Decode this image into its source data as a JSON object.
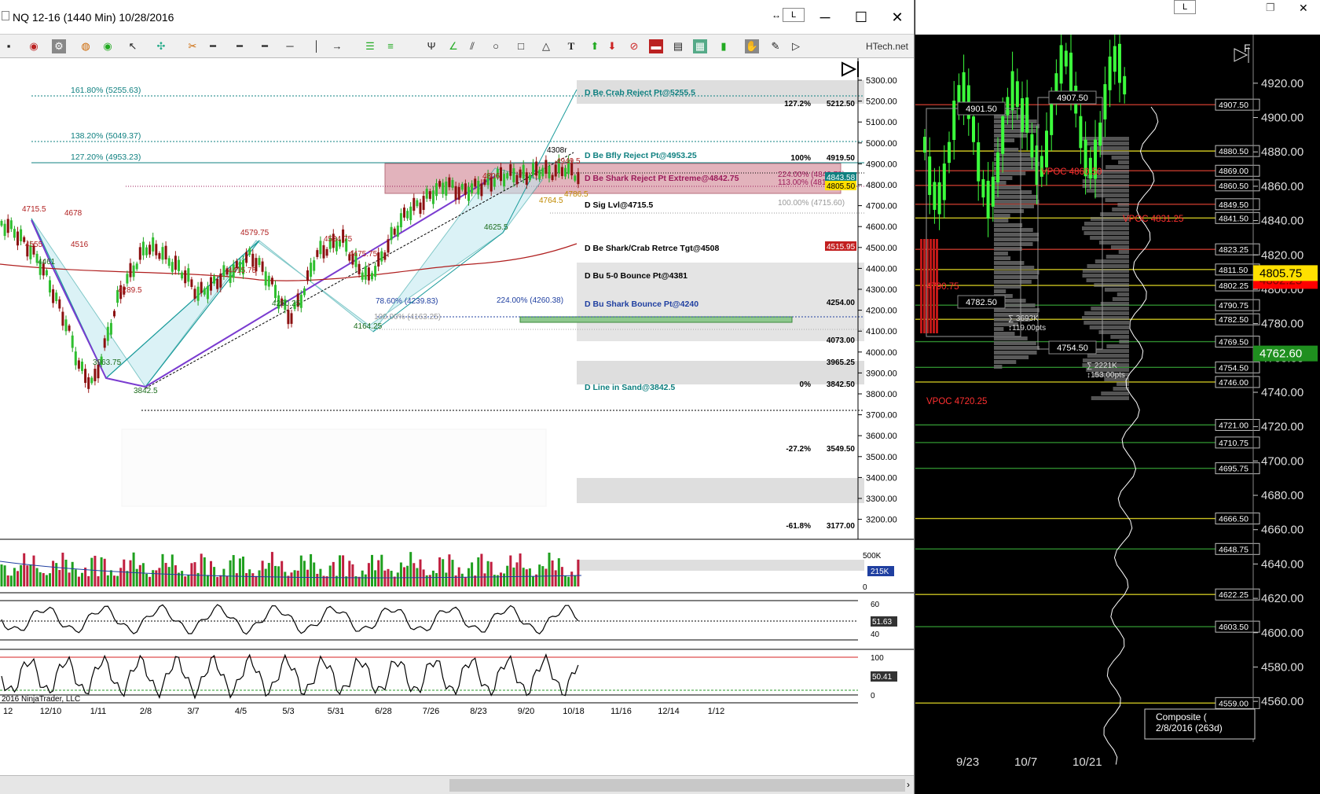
{
  "left_window": {
    "title": "NQ 12-16 (1440 Min)  10/28/2016",
    "buttons": {
      "minimize": "─",
      "maximize": "☐",
      "close": "✕",
      "link": "L"
    },
    "toolbar_brand": "HTech.net",
    "price_axis": [
      "5300.00",
      "5200.00",
      "5100.00",
      "5000.00",
      "4900.00",
      "4800.00",
      "4700.00",
      "4600.00",
      "4500.00",
      "4400.00",
      "4300.00",
      "4200.00",
      "4100.00",
      "4000.00",
      "3900.00",
      "3800.00",
      "3700.00",
      "3600.00",
      "3500.00",
      "3400.00",
      "3300.00",
      "3200.00"
    ],
    "date_axis": [
      "12",
      "12/10",
      "1/11",
      "2/8",
      "3/7",
      "4/5",
      "5/3",
      "5/31",
      "6/28",
      "7/26",
      "8/23",
      "9/20",
      "10/18",
      "11/16",
      "12/14",
      "1/12"
    ],
    "fib_labels": [
      "161.80% (5255.63)",
      "138.20% (5049.37)",
      "127.20% (4953.23)"
    ],
    "zones": [
      {
        "label": "D Be Crab Reject Pt@5255.5",
        "color": "#0f8080"
      },
      {
        "label": "D Be Bfly Reject Pt@4953.25",
        "color": "#0f8080"
      },
      {
        "label": "D Be Shark Reject Pt Extreme@4842.75",
        "color": "#9b1b5a"
      },
      {
        "label": "D Sig Lvl@4715.5",
        "color": "#000000"
      },
      {
        "label": "D Be Shark/Crab Retrce Tgt@4508",
        "color": "#000000"
      },
      {
        "label": "D Bu 5-0 Bounce Pt@4381",
        "color": "#000000"
      },
      {
        "label": "D Bu Shark Bounce Pt@4240",
        "color": "#1f3fa0"
      },
      {
        "label": "D Line in Sand@3842.5",
        "color": "#0f8080"
      }
    ],
    "level_labels": [
      {
        "pct": "127.2%",
        "price": "5212.50"
      },
      {
        "pct": "100%",
        "price": "4919.50"
      },
      {
        "pct": "",
        "price": "4508.00"
      },
      {
        "pct": "",
        "price": "4254.00"
      },
      {
        "pct": "",
        "price": "4073.00"
      },
      {
        "pct": "",
        "price": "3965.25"
      },
      {
        "pct": "0%",
        "price": "3842.50"
      },
      {
        "pct": "-27.2%",
        "price": "3549.50"
      },
      {
        "pct": "-61.8%",
        "price": "3177.00"
      }
    ],
    "small_labels": [
      "224.00% (4842.78)",
      "113.00% (4817.30)",
      "100.00% (4715.60)",
      "224.00% (4260.38)",
      "78.60% (4239.83)",
      "100.00% (4163.25)"
    ],
    "price_tags": {
      "high": "4843.58",
      "current": "4805.50",
      "ma": "4515.95",
      "volume": "215K",
      "rsi": "51.63",
      "stoch": "50.41"
    },
    "pivot_labels": [
      "4715.5",
      "4678",
      "4555",
      "4461",
      "4516",
      "3963.75",
      "3842.5",
      "4289.5",
      "4579.75",
      "4415.75",
      "4260.25",
      "4534.75",
      "4475.75",
      "4164.25",
      "4806",
      "4625.5",
      "4308r",
      "4949.5",
      "4764.5",
      "4786.5"
    ],
    "volume_axis": [
      "500K",
      "0"
    ],
    "rsi_axis": [
      "60",
      "40"
    ],
    "stoch_axis": [
      "100",
      "0"
    ],
    "copyright": "2016 NinjaTrader, LLC",
    "panel_button": "F"
  },
  "right_window": {
    "buttons": {
      "link": "L",
      "restore": "❐",
      "close": "✕",
      "panel": "F"
    },
    "price_axis": [
      "4920.00",
      "4900.00",
      "4880.00",
      "4860.00",
      "4840.00",
      "4820.00",
      "4800.00",
      "4780.00",
      "4760.00",
      "4740.00",
      "4720.00",
      "4700.00",
      "4680.00",
      "4660.00",
      "4640.00",
      "4620.00",
      "4600.00",
      "4580.00",
      "4560.00"
    ],
    "levels": [
      {
        "price": "4907.50",
        "color": "#c0392b"
      },
      {
        "price": "4880.50",
        "color": "#c8c020"
      },
      {
        "price": "4869.00",
        "color": "#c0392b"
      },
      {
        "price": "4860.50",
        "color": "#c0392b"
      },
      {
        "price": "4849.50",
        "color": "#c0392b"
      },
      {
        "price": "4841.50",
        "color": "#c8c020"
      },
      {
        "price": "4823.25",
        "color": "#c0392b"
      },
      {
        "price": "4811.50",
        "color": "#c8c020"
      },
      {
        "price": "4802.25",
        "color": "#c8c020"
      },
      {
        "price": "4790.75",
        "color": "#2e8b2e"
      },
      {
        "price": "4782.50",
        "color": "#c8c020"
      },
      {
        "price": "4769.50",
        "color": "#2e8b2e"
      },
      {
        "price": "4754.50",
        "color": "#2e8b2e"
      },
      {
        "price": "4746.00",
        "color": "#c8c020"
      },
      {
        "price": "4721.00",
        "color": "#2e8b2e"
      },
      {
        "price": "4710.75",
        "color": "#2e8b2e"
      },
      {
        "price": "4695.75",
        "color": "#2e8b2e"
      },
      {
        "price": "4666.50",
        "color": "#c8c020"
      },
      {
        "price": "4648.75",
        "color": "#2e8b2e"
      },
      {
        "price": "4622.25",
        "color": "#c8c020"
      },
      {
        "price": "4603.50",
        "color": "#2e8b2e"
      },
      {
        "price": "4559.00",
        "color": "#c8c020"
      }
    ],
    "box_labels": [
      "4901.50",
      "4907.50",
      "4782.50",
      "4754.50"
    ],
    "vpoc_labels": [
      "VPOC 4860.50",
      "VPOC 4831.25",
      "VPOC 4720.25",
      "4790.75"
    ],
    "stats": [
      "∑ 3693K",
      "↕119.00pts",
      "∑ 2221K",
      "↕153.00pts"
    ],
    "current_price": "4805.75",
    "current_price_hidden": "4802.25",
    "last_price": "4762.60",
    "composite": [
      "Composite (",
      "2/8/2016 (263d)"
    ],
    "date_axis": [
      "9/23",
      "10/7",
      "10/21"
    ]
  }
}
